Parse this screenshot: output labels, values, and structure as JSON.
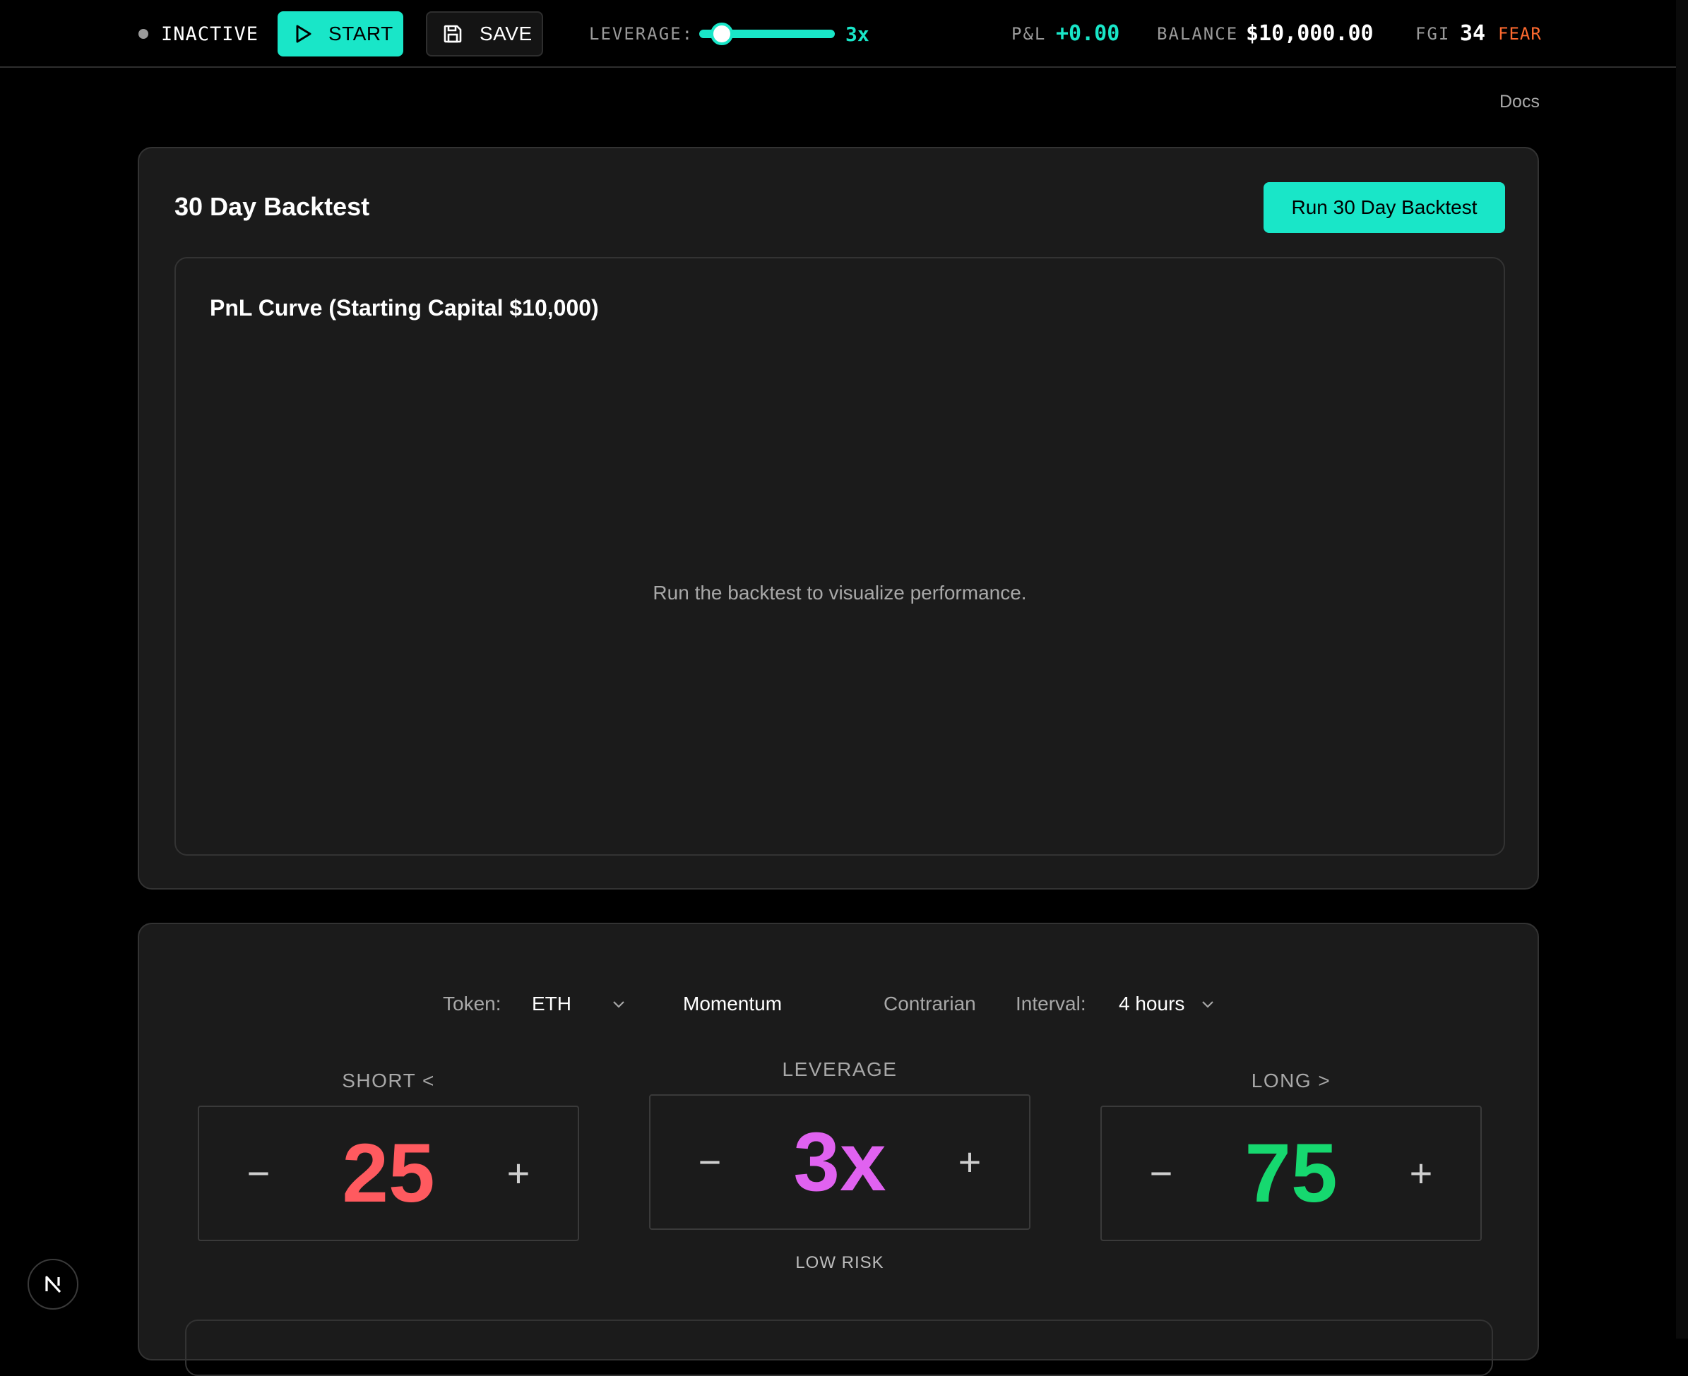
{
  "topbar": {
    "status_label": "INACTIVE",
    "start_label": "START",
    "save_label": "SAVE",
    "leverage_label": "LEVERAGE:",
    "leverage_value_text": "3x",
    "leverage_slider_fraction": 0.1,
    "pnl_label": "P&L",
    "pnl_value": "+0.00",
    "balance_label": "BALANCE",
    "balance_value": "$10,000.00",
    "fgi_label": "FGI",
    "fgi_value": "34",
    "fgi_sentiment": "FEAR",
    "colors": {
      "accent": "#19e6c8",
      "fear": "#ff6a2f",
      "inactive_dot": "#9a9a9a"
    }
  },
  "nav": {
    "docs_label": "Docs"
  },
  "backtest": {
    "title": "30 Day Backtest",
    "run_button_label": "Run 30 Day Backtest",
    "chart_title": "PnL Curve (Starting Capital $10,000)",
    "empty_message": "Run the backtest to visualize performance."
  },
  "settings": {
    "token_label": "Token:",
    "token_value": "ETH",
    "mode_momentum": "Momentum",
    "mode_contrarian": "Contrarian",
    "interval_label": "Interval:",
    "interval_value": "4 hours",
    "short": {
      "label": "SHORT <",
      "value": "25",
      "minus": "−",
      "plus": "+",
      "color": "#ff5a5f"
    },
    "leverage": {
      "label": "LEVERAGE",
      "value": "3x",
      "minus": "−",
      "plus": "+",
      "risk": "LOW RISK",
      "color": "#e062f0"
    },
    "long": {
      "label": "LONG >",
      "value": "75",
      "minus": "−",
      "plus": "+",
      "color": "#16d86f"
    }
  },
  "icons": {
    "start": "play-icon",
    "save": "floppy-disk-icon",
    "dropdown": "chevron-down-icon",
    "framework": "nextjs-logo-icon"
  }
}
